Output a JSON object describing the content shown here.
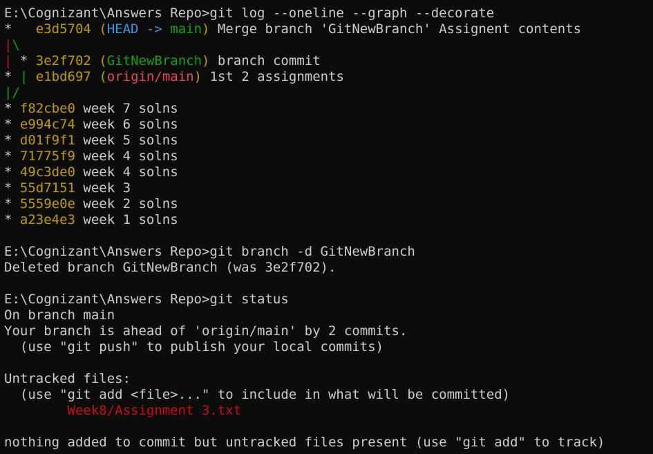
{
  "colors": {
    "background": "#0c0c0c",
    "default": "#cccccc",
    "hash": "#c19c00",
    "head": "#3a96dd",
    "branch": "#13a10e",
    "remote": "#e74856",
    "graph_red": "#c50f1f",
    "graph_green": "#13a10e",
    "untracked": "#c50f1f"
  },
  "lines": [
    {
      "segments": [
        {
          "text": "E:\\Cognizant\\Answers Repo>git log --oneline --graph --decorate",
          "color": "default"
        }
      ]
    },
    {
      "segments": [
        {
          "text": "*   ",
          "color": "default"
        },
        {
          "text": "e3d5704",
          "color": "hash"
        },
        {
          "text": " (",
          "color": "hash"
        },
        {
          "text": "HEAD -> ",
          "color": "head"
        },
        {
          "text": "main",
          "color": "branch"
        },
        {
          "text": ")",
          "color": "hash"
        },
        {
          "text": " Merge branch 'GitNewBranch' Assignent contents",
          "color": "default"
        }
      ]
    },
    {
      "segments": [
        {
          "text": "|",
          "color": "graph_red"
        },
        {
          "text": "\\",
          "color": "graph_green"
        }
      ]
    },
    {
      "segments": [
        {
          "text": "|",
          "color": "graph_red"
        },
        {
          "text": " * ",
          "color": "default"
        },
        {
          "text": "3e2f702",
          "color": "hash"
        },
        {
          "text": " (",
          "color": "hash"
        },
        {
          "text": "GitNewBranch",
          "color": "branch"
        },
        {
          "text": ")",
          "color": "hash"
        },
        {
          "text": " branch commit",
          "color": "default"
        }
      ]
    },
    {
      "segments": [
        {
          "text": "* ",
          "color": "default"
        },
        {
          "text": "|",
          "color": "graph_green"
        },
        {
          "text": " ",
          "color": "default"
        },
        {
          "text": "e1bd697",
          "color": "hash"
        },
        {
          "text": " (",
          "color": "hash"
        },
        {
          "text": "origin/main",
          "color": "remote"
        },
        {
          "text": ")",
          "color": "hash"
        },
        {
          "text": " 1st 2 assignments",
          "color": "default"
        }
      ]
    },
    {
      "segments": [
        {
          "text": "|/",
          "color": "graph_green"
        }
      ]
    },
    {
      "segments": [
        {
          "text": "* ",
          "color": "default"
        },
        {
          "text": "f82cbe0",
          "color": "hash"
        },
        {
          "text": " week 7 solns",
          "color": "default"
        }
      ]
    },
    {
      "segments": [
        {
          "text": "* ",
          "color": "default"
        },
        {
          "text": "e994c74",
          "color": "hash"
        },
        {
          "text": " week 6 solns",
          "color": "default"
        }
      ]
    },
    {
      "segments": [
        {
          "text": "* ",
          "color": "default"
        },
        {
          "text": "d01f9f1",
          "color": "hash"
        },
        {
          "text": " week 5 solns",
          "color": "default"
        }
      ]
    },
    {
      "segments": [
        {
          "text": "* ",
          "color": "default"
        },
        {
          "text": "71775f9",
          "color": "hash"
        },
        {
          "text": " week 4 solns",
          "color": "default"
        }
      ]
    },
    {
      "segments": [
        {
          "text": "* ",
          "color": "default"
        },
        {
          "text": "49c3de0",
          "color": "hash"
        },
        {
          "text": " week 4 solns",
          "color": "default"
        }
      ]
    },
    {
      "segments": [
        {
          "text": "* ",
          "color": "default"
        },
        {
          "text": "55d7151",
          "color": "hash"
        },
        {
          "text": " week 3",
          "color": "default"
        }
      ]
    },
    {
      "segments": [
        {
          "text": "* ",
          "color": "default"
        },
        {
          "text": "5559e0e",
          "color": "hash"
        },
        {
          "text": " week 2 solns",
          "color": "default"
        }
      ]
    },
    {
      "segments": [
        {
          "text": "* ",
          "color": "default"
        },
        {
          "text": "a23e4e3",
          "color": "hash"
        },
        {
          "text": " week 1 solns",
          "color": "default"
        }
      ]
    },
    {
      "segments": []
    },
    {
      "segments": [
        {
          "text": "E:\\Cognizant\\Answers Repo>git branch -d GitNewBranch",
          "color": "default"
        }
      ]
    },
    {
      "segments": [
        {
          "text": "Deleted branch GitNewBranch (was 3e2f702).",
          "color": "default"
        }
      ]
    },
    {
      "segments": []
    },
    {
      "segments": [
        {
          "text": "E:\\Cognizant\\Answers Repo>git status",
          "color": "default"
        }
      ]
    },
    {
      "segments": [
        {
          "text": "On branch main",
          "color": "default"
        }
      ]
    },
    {
      "segments": [
        {
          "text": "Your branch is ahead of 'origin/main' by 2 commits.",
          "color": "default"
        }
      ]
    },
    {
      "segments": [
        {
          "text": "  (use \"git push\" to publish your local commits)",
          "color": "default"
        }
      ]
    },
    {
      "segments": []
    },
    {
      "segments": [
        {
          "text": "Untracked files:",
          "color": "default"
        }
      ]
    },
    {
      "segments": [
        {
          "text": "  (use \"git add <file>...\" to include in what will be committed)",
          "color": "default"
        }
      ]
    },
    {
      "segments": [
        {
          "text": "        ",
          "color": "default"
        },
        {
          "text": "Week8/Assignment 3.txt",
          "color": "untracked"
        }
      ]
    },
    {
      "segments": []
    },
    {
      "segments": [
        {
          "text": "nothing added to commit but untracked files present (use \"git add\" to track)",
          "color": "default"
        }
      ]
    }
  ]
}
